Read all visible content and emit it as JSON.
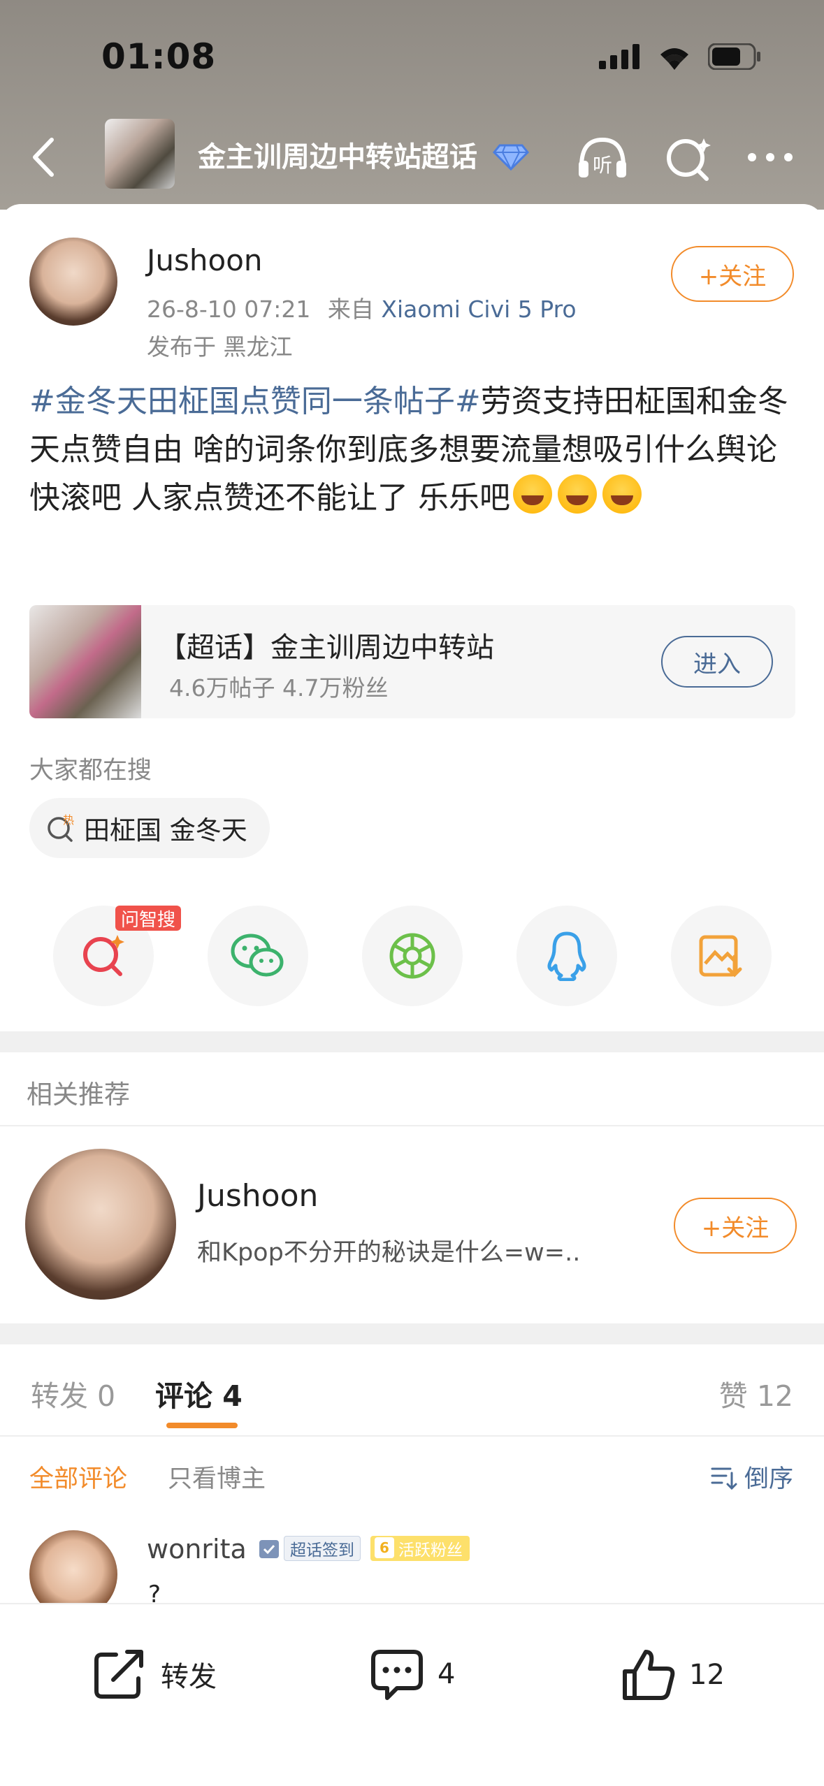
{
  "status_bar": {
    "time": "01:08"
  },
  "header": {
    "title": "金主训周边中转站超话"
  },
  "post": {
    "author": "Jushoon",
    "follow_label": "+关注",
    "datetime": "26-8-10 07:21",
    "from_prefix": "来自",
    "device": "Xiaomi Civi 5 Pro",
    "location": "发布于 黑龙江",
    "hashtag": "#金冬天田柾国点赞同一条帖子#",
    "body": "劳资支持田柾国和金冬天点赞自由 啥的词条你到底多想要流量想吸引什么舆论 快滚吧 人家点赞还不能让了 乐乐吧"
  },
  "supertopic": {
    "title": "【超话】金主训周边中转站",
    "stats": "4.6万帖子  4.7万粉丝",
    "enter_label": "进入"
  },
  "search": {
    "heading": "大家都在搜",
    "chip_label": "田柾国 金冬天",
    "hot_label": "热"
  },
  "share": {
    "badge": "问智搜",
    "items": [
      "search-ai-icon",
      "wechat-icon",
      "moments-icon",
      "qq-icon",
      "save-image-icon"
    ]
  },
  "recommend": {
    "heading": "相关推荐",
    "name": "Jushoon",
    "desc": "和Kpop不分开的秘诀是什么=w=..",
    "follow_label": "+关注"
  },
  "tabs": {
    "repost": "转发 0",
    "comment": "评论 4",
    "like": "赞 12"
  },
  "filters": {
    "all": "全部评论",
    "author_only": "只看博主",
    "sort": "倒序"
  },
  "comment": {
    "name": "wonrita",
    "badge_checkin": "超话签到",
    "badge_fan": "活跃粉丝",
    "text": "?"
  },
  "bottom_bar": {
    "repost_label": "转发",
    "comment_count": "4",
    "like_count": "12"
  },
  "colors": {
    "accent": "#f28b2a",
    "link": "#4a6b96"
  }
}
